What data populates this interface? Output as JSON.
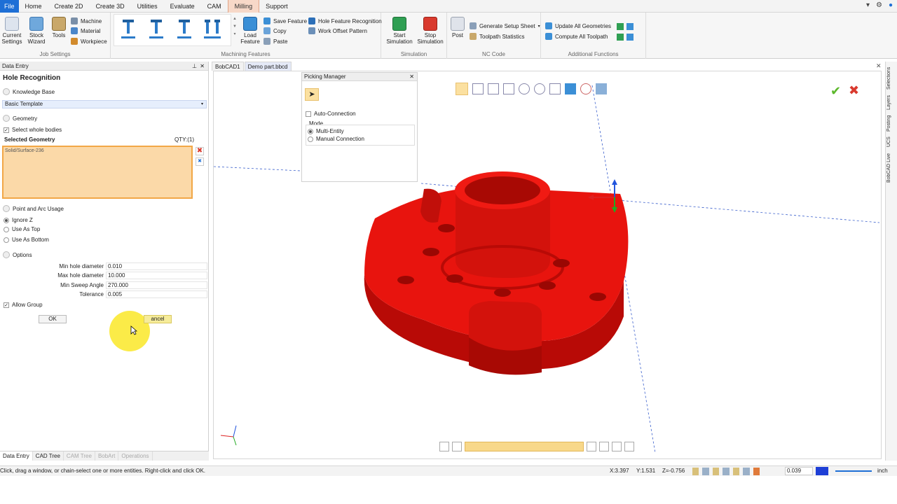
{
  "menu": {
    "items": [
      "File",
      "Home",
      "Create 2D",
      "Create 3D",
      "Utilities",
      "Evaluate",
      "CAM",
      "Milling",
      "Support"
    ],
    "active": "Milling"
  },
  "ribbon": {
    "job_settings": {
      "label": "Job Settings",
      "current_settings": "Current Settings",
      "stock_wizard": "Stock Wizard",
      "tools": "Tools",
      "machine": "Machine",
      "material": "Material",
      "workpiece": "Workpiece"
    },
    "machining_features": {
      "label": "Machining Features",
      "load_feature": "Load Feature",
      "save_feature": "Save Feature",
      "copy": "Copy",
      "paste": "Paste",
      "hole_feature_recognition": "Hole Feature Recognition",
      "work_offset_pattern": "Work Offset Pattern"
    },
    "simulation": {
      "label": "Simulation",
      "start": "Start Simulation",
      "stop": "Stop Simulation"
    },
    "nc_code": {
      "label": "NC Code",
      "post": "Post",
      "generate_setup_sheet": "Generate Setup Sheet",
      "toolpath_statistics": "Toolpath Statistics"
    },
    "additional": {
      "label": "Additional Functions",
      "update_all": "Update All Geometries",
      "compute_all": "Compute All Toolpath"
    }
  },
  "data_entry": {
    "header": "Data Entry",
    "title": "Hole Recognition",
    "knowledge_base": "Knowledge Base",
    "template": "Basic Template",
    "geometry": "Geometry",
    "select_whole_bodies": "Select whole bodies",
    "selected_geometry": "Selected Geometry",
    "qty": "QTY:(1)",
    "selected_item": "Solid/Surface-236",
    "point_arc_usage": "Point and Arc Usage",
    "radios": [
      "Ignore Z",
      "Use As Top",
      "Use As Bottom"
    ],
    "options": "Options",
    "params": [
      {
        "label": "Min hole diameter",
        "value": "0.010"
      },
      {
        "label": "Max hole diameter",
        "value": "10.000"
      },
      {
        "label": "Min Sweep Angle",
        "value": "270.000"
      },
      {
        "label": "Tolerance",
        "value": "0.005"
      }
    ],
    "allow_group": "Allow Group",
    "ok": "OK",
    "cancel": "ancel"
  },
  "bottom_tabs": [
    "Data Entry",
    "CAD Tree",
    "CAM Tree",
    "BobArt",
    "Operations"
  ],
  "doc_tabs": [
    "BobCAD1",
    "Demo part.bbcd"
  ],
  "picking_manager": {
    "title": "Picking Manager",
    "auto_connection": "Auto-Connection",
    "mode": "Mode",
    "multi_entity": "Multi-Entity",
    "manual_connection": "Manual Connection"
  },
  "side_tabs": [
    "Selections",
    "Layers",
    "Posting",
    "UCS",
    "BobCAD Live"
  ],
  "status": {
    "message": "Click, drag a window, or chain-select one or more entities. Right-click and click OK.",
    "x": "X:3.397",
    "y": "Y:1.531",
    "z": "Z=-0.756",
    "value": "0.039",
    "units": "inch"
  },
  "colors": {
    "part": "#e8140e",
    "accent": "#1e6fd6",
    "highlight": "#fbd9a8"
  }
}
